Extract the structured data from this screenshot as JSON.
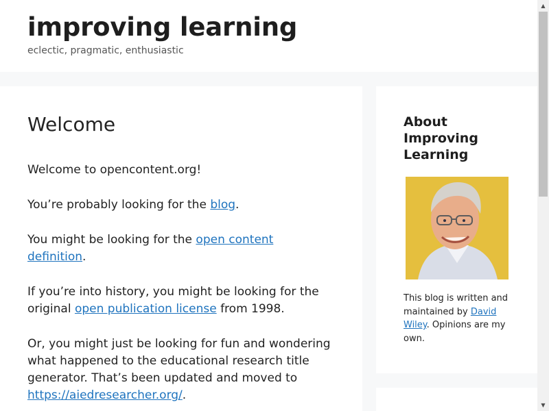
{
  "header": {
    "title": "improving learning",
    "tagline": "eclectic, pragmatic, enthusiastic"
  },
  "main": {
    "title": "Welcome",
    "p1": "Welcome to opencontent.org!",
    "p2_before": "You’re probably looking for the ",
    "p2_link": "blog",
    "p2_after": ".",
    "p3_before": "You might be looking for the ",
    "p3_link": "open content definition",
    "p3_after": ".",
    "p4_before": "If you’re into history, you might be looking for the original ",
    "p4_link": "open publication license",
    "p4_after": " from 1998.",
    "p5_text": "Or, you might just be looking for fun and wondering what happened to the educational research title generator. That’s been updated and moved to ",
    "p5_link": "https://aiedresearcher.org/",
    "p5_after": "."
  },
  "sidebar": {
    "widget_title": "About Improving Learning",
    "photo_icon": "author-photo",
    "text_before": "This blog is written and maintained by ",
    "author_link": "David Wiley",
    "text_after": ". Opinions are my own."
  },
  "colors": {
    "link": "#1e73be",
    "background": "#f7f8f9",
    "panel": "#ffffff",
    "photo_bg": "#e6bf3c"
  }
}
